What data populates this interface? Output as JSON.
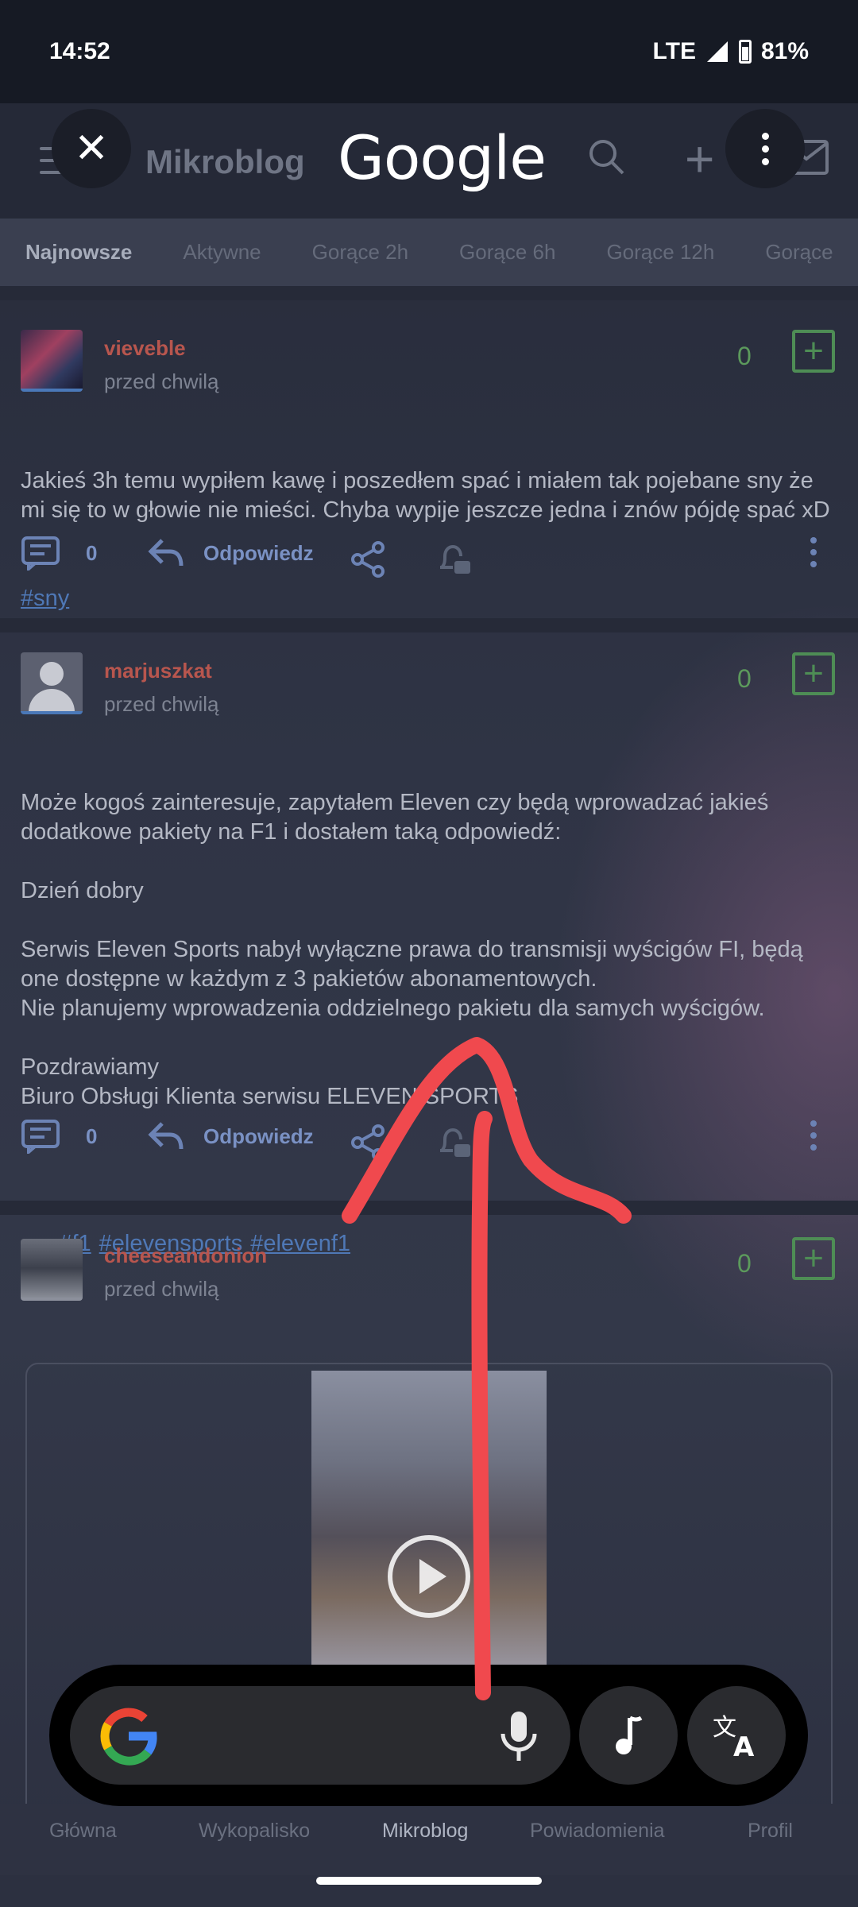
{
  "status": {
    "time": "14:52",
    "network": "LTE",
    "battery": "81%"
  },
  "topbar": {
    "title": "Mikroblog",
    "logo": "Google"
  },
  "tabs": [
    "Najnowsze",
    "Aktywne",
    "Gorące 2h",
    "Gorące 6h",
    "Gorące 12h",
    "Gorące"
  ],
  "posts": [
    {
      "user": "vieveble",
      "time": "przed chwilą",
      "votes": "0",
      "text": "Jakieś 3h temu wypiłem kawę i poszedłem spać i miałem tak pojebane sny że mi się to w głowie nie mieści. Chyba wypije jeszcze jedna i znów pójdę spać xD",
      "tags": [
        "#sny"
      ],
      "comments": "0",
      "reply": "Odpowiedz"
    },
    {
      "user": "marjuszkat",
      "time": "przed chwilą",
      "votes": "0",
      "text": "Może kogoś zainteresuje, zapytałem Eleven czy będą wprowadzać jakieś dodatkowe pakiety na F1 i dostałem taką odpowiedź:\n\nDzień dobry\n\nSerwis Eleven Sports nabył wyłączne prawa do transmisji wyścigów FI, będą one dostępne w każdym z 3 pakietów abonamentowych.\nNie planujemy wprowadzenia oddzielnego pakietu dla samych wyścigów.\n\nPozdrawiamy\nBiuro Obsługi Klienta serwisu ELEVEN SPORTS",
      "tags": [
        "#f1",
        "#elevensports",
        "#elevenf1"
      ],
      "comments": "0",
      "reply": "Odpowiedz"
    },
    {
      "user": "cheeseandonion",
      "time": "przed chwilą",
      "votes": "0"
    }
  ],
  "bottom_nav": [
    "Główna",
    "Wykopalisko",
    "Mikroblog",
    "Powiadomienia",
    "Profil"
  ],
  "colors": {
    "username": "#b8564e",
    "vote": "#4e8d55",
    "link": "#4f78b6",
    "arrow": "#f0494e"
  }
}
